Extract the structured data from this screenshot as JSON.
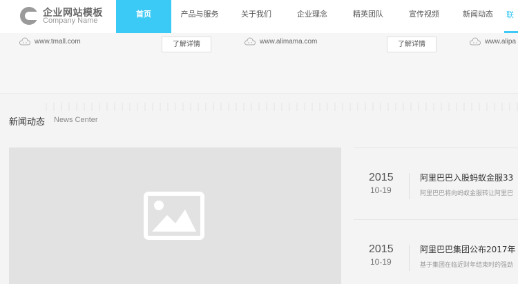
{
  "header": {
    "logo_title": "企业网站模板",
    "logo_subtitle": "Company Name",
    "nav": [
      {
        "label": "首页",
        "active": true
      },
      {
        "label": "产品与服务",
        "active": false
      },
      {
        "label": "关于我们",
        "active": false
      },
      {
        "label": "企业理念",
        "active": false
      },
      {
        "label": "精英团队",
        "active": false
      },
      {
        "label": "宣传视频",
        "active": false
      },
      {
        "label": "新闻动态",
        "active": false
      }
    ],
    "nav_partial_label": "联"
  },
  "partners": [
    {
      "url": "www.tmall.com",
      "button": "了解详情"
    },
    {
      "url": "www.alimama.com",
      "button": "了解详情"
    },
    {
      "url": "www.alipa"
    }
  ],
  "news": {
    "title": "新闻动态",
    "title_en": "News Center",
    "items": [
      {
        "year": "2015",
        "date": "10-19",
        "title": "阿里巴巴入股蚂蚁金服33",
        "desc": "阿里巴巴将向蚂蚁金服转让阿里巴"
      },
      {
        "year": "2015",
        "date": "10-19",
        "title": "阿里巴巴集团公布2017年",
        "desc": "基于集团在临近财年结束时的强劲"
      }
    ]
  },
  "colors": {
    "accent": "#3bc9f5"
  }
}
